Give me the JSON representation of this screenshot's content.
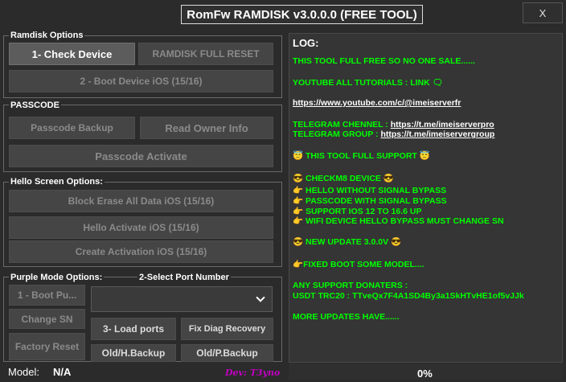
{
  "window": {
    "title": "RomFw RAMDISK v3.0.0.0 (FREE TOOL)",
    "close_label": "X"
  },
  "ramdisk": {
    "label": "Ramdisk Options",
    "check_device": "1- Check Device",
    "full_reset": "RAMDISK FULL RESET",
    "boot_device": "2 - Boot Device iOS (15/16)"
  },
  "passcode": {
    "label": "PASSCODE",
    "backup": "Passcode Backup",
    "read_owner": "Read Owner Info",
    "activate": "Passcode Activate"
  },
  "hello": {
    "label": "Hello Screen Options:",
    "block_erase": "Block Erase All Data iOS (15/16)",
    "activate": "Hello Activate iOS (15/16)",
    "create_activation": "Create Activation iOS (15/16)"
  },
  "purple": {
    "label": "Purple Mode Options:",
    "boot": "1 - Boot Pu...",
    "change_sn": "Change SN",
    "factory_reset": "Factory Reset"
  },
  "port": {
    "label": "2-Select Port Number",
    "selected": "",
    "load_ports": "3- Load ports",
    "fix_diag": "Fix Diag Recovery",
    "old_h_backup": "Old/H.Backup",
    "old_p_backup": "Old/P.Backup"
  },
  "footer": {
    "model_label": "Model:",
    "model_value": "N/A",
    "dev": "Dev: T3yno"
  },
  "log": {
    "title": "LOG:",
    "line1": "THIS TOOL FULL FREE SO NO ONE SALE......",
    "line2": "YOUTUBE ALL TUTORIALS : LINK 🗨",
    "youtube_link": "https://www.youtube.com/c/@imeiserverfr",
    "tg_channel_label": "TELEGRAM CHENNEL : ",
    "tg_channel_link": "https://t.me/imeiserverpro",
    "tg_group_label": "TELEGRAM GROUP     : ",
    "tg_group_link": "https://t.me/imeiservergroup",
    "support": "😇 THIS TOOL FULL SUPPORT 😇",
    "checkm8": "😎 CHECKM8 DEVICE 😎",
    "f1": "👉 HELLO WITHOUT SIGNAL BYPASS",
    "f2": "👉 PASSCODE WITH SIGNAL BYPASS",
    "f3": "👉 SUPPORT IOS 12 TO 16.6 UP",
    "f4": "👉 WIFI DEVICE HELLO BYPASS MUST CHANGE SN",
    "update": "😎 NEW UPDATE 3.0.0V 😎",
    "fixed": "👉FIXED BOOT SOME MODEL....",
    "donaters": "ANY SUPPORT DONATERS :",
    "usdt": "USDT TRC20 : TTveQx7F4A1SD4By3a1SkHTvHE1of5vJJk",
    "more": "MORE UPDATES HAVE......"
  },
  "progress": {
    "percent_label": "0%",
    "value": 0
  },
  "colors": {
    "log_text": "#00ff00",
    "dev_text": "#c000c0",
    "background": "#2b2b2b"
  }
}
